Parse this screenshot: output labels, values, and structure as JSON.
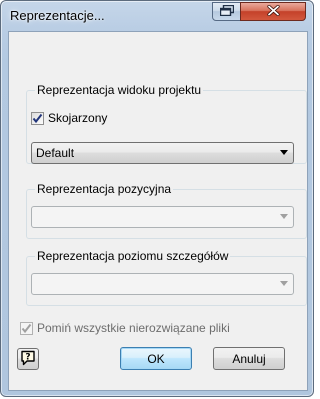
{
  "window": {
    "title": "Reprezentacje..."
  },
  "groups": {
    "view": {
      "label": "Reprezentacja widoku projektu",
      "associative_label": "Skojarzony",
      "associative_checked": true,
      "combo_value": "Default"
    },
    "position": {
      "label": "Reprezentacja pozycyjna",
      "combo_value": ""
    },
    "lod": {
      "label": "Reprezentacja poziomu szczegółów",
      "combo_value": ""
    }
  },
  "options": {
    "skip_unresolved_label": "Pomiń wszystkie nierozwiązane pliki",
    "skip_unresolved_checked": true,
    "skip_unresolved_enabled": false
  },
  "buttons": {
    "ok": "OK",
    "cancel": "Anuluj",
    "help_icon": "help-question-icon"
  },
  "titlebar_buttons": {
    "restore_icon": "restore-icon",
    "close_icon": "close-icon"
  },
  "colors": {
    "title_bar": "#b9cde4",
    "client_bg": "#f0f0f0",
    "close_button": "#c4412a",
    "default_button_border": "#3c7fb1",
    "disabled_text": "#6d6d6d"
  }
}
